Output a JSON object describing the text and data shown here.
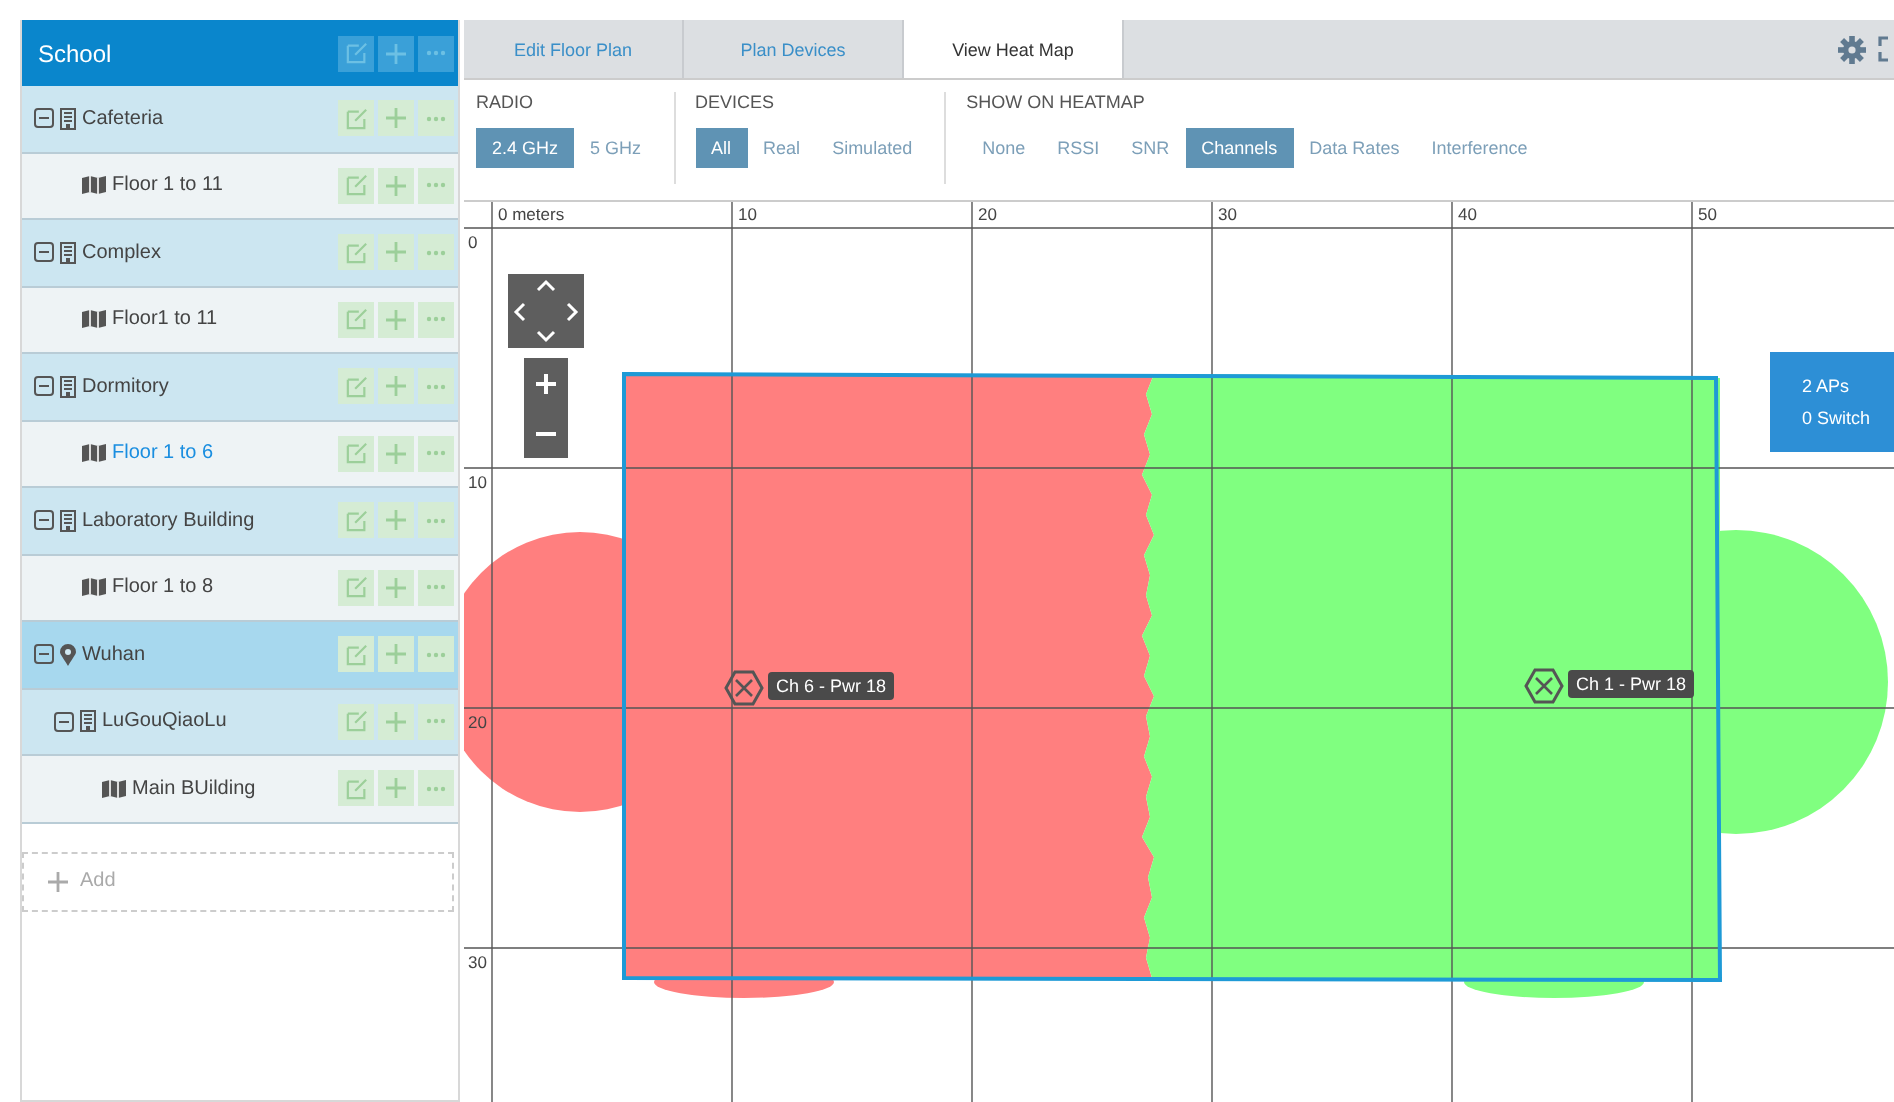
{
  "sidebar": {
    "title": "School",
    "items": [
      {
        "kind": "building",
        "label": "Cafeteria",
        "expanded": true,
        "selected": false,
        "highlighted": false,
        "children": [
          {
            "kind": "floor",
            "label": "Floor 1 to 11",
            "selected": false,
            "highlighted": false
          }
        ]
      },
      {
        "kind": "building",
        "label": "Complex",
        "expanded": true,
        "selected": false,
        "highlighted": false,
        "children": [
          {
            "kind": "floor",
            "label": "Floor1 to 11",
            "selected": false,
            "highlighted": false
          }
        ]
      },
      {
        "kind": "building",
        "label": "Dormitory",
        "expanded": true,
        "selected": false,
        "highlighted": false,
        "children": [
          {
            "kind": "floor",
            "label": "Floor 1 to 6",
            "selected": true,
            "highlighted": false
          }
        ]
      },
      {
        "kind": "building",
        "label": "Laboratory Building",
        "expanded": true,
        "selected": false,
        "highlighted": false,
        "children": [
          {
            "kind": "floor",
            "label": "Floor 1 to 8",
            "selected": false,
            "highlighted": false
          }
        ]
      },
      {
        "kind": "location",
        "label": "Wuhan",
        "expanded": true,
        "selected": false,
        "highlighted": true,
        "children": [
          {
            "kind": "building",
            "label": "LuGouQiaoLu",
            "expanded": true,
            "selected": false,
            "highlighted": false,
            "children": [
              {
                "kind": "floor",
                "label": "Main BUilding",
                "selected": false,
                "highlighted": false
              }
            ]
          }
        ]
      }
    ],
    "add_label": "Add"
  },
  "tabs": [
    {
      "label": "Edit Floor Plan",
      "selected": false
    },
    {
      "label": "Plan Devices",
      "selected": false
    },
    {
      "label": "View Heat Map",
      "selected": true
    }
  ],
  "filters": [
    {
      "title": "RADIO",
      "options": [
        {
          "label": "2.4 GHz",
          "selected": true
        },
        {
          "label": "5 GHz",
          "selected": false
        }
      ]
    },
    {
      "title": "DEVICES",
      "options": [
        {
          "label": "All",
          "selected": true
        },
        {
          "label": "Real",
          "selected": false
        },
        {
          "label": "Simulated",
          "selected": false
        }
      ]
    },
    {
      "title": "SHOW ON HEATMAP",
      "options": [
        {
          "label": "None",
          "selected": false
        },
        {
          "label": "RSSI",
          "selected": false
        },
        {
          "label": "SNR",
          "selected": false
        },
        {
          "label": "Channels",
          "selected": true
        },
        {
          "label": "Data Rates",
          "selected": false
        },
        {
          "label": "Interference",
          "selected": false
        }
      ]
    }
  ],
  "map": {
    "x_labels": [
      "0 meters",
      "10",
      "20",
      "30",
      "40",
      "50"
    ],
    "y_labels": [
      "0",
      "10",
      "20",
      "30"
    ],
    "access_points": [
      {
        "label": "Ch 6 - Pwr 18",
        "color": "#ff7f7f"
      },
      {
        "label": "Ch 1 - Pwr 18",
        "color": "#80ff80"
      }
    ],
    "summary": [
      "2 APs",
      "0 Switch"
    ]
  }
}
